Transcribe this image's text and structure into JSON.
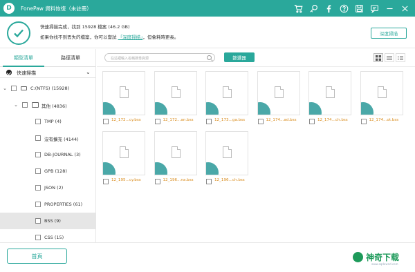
{
  "titlebar": {
    "logo_letter": "D",
    "app_name": "FonePaw 資料恢復（未註冊）",
    "icons": [
      "cart-icon",
      "key-icon",
      "facebook-icon",
      "help-icon",
      "save-icon",
      "feedback-icon",
      "minimize-icon",
      "close-icon"
    ]
  },
  "status": {
    "line1": "快速掃描完成，找到 15928 檔案 (46.2 GB)",
    "line2_prefix": "如果你找不到丟失的檔案，你可以嘗試 ",
    "line2_link": "「深度掃描」",
    "line2_suffix": "，但會耗時更長。",
    "deep_scan_button": "深度掃描"
  },
  "left": {
    "tabs": [
      "類型清單",
      "路徑清單"
    ],
    "mode_label": "快速掃描",
    "tree": [
      {
        "label": "C:(NTFS) (15928)",
        "level": 0,
        "type": "drive",
        "expanded": true
      },
      {
        "label": "其他 (4836)",
        "level": 1,
        "type": "folder",
        "expanded": true
      },
      {
        "label": "TMP (4)",
        "level": 2,
        "type": "item"
      },
      {
        "label": "沒有擴充 (4144)",
        "level": 2,
        "type": "item"
      },
      {
        "label": "DB-JOURNAL (3)",
        "level": 2,
        "type": "item"
      },
      {
        "label": "GPB (128)",
        "level": 2,
        "type": "item"
      },
      {
        "label": "JSON (2)",
        "level": 2,
        "type": "item"
      },
      {
        "label": "PROPERTIES (61)",
        "level": 2,
        "type": "item"
      },
      {
        "label": "BSS (9)",
        "level": 2,
        "type": "item",
        "selected": true
      },
      {
        "label": "CSS (15)",
        "level": 2,
        "type": "item"
      }
    ]
  },
  "toolbar": {
    "search_placeholder": "在這裡輸入名稱搜尋資源",
    "filter_button": "篩選器",
    "views": [
      "grid-view-icon",
      "list-view-icon",
      "detail-view-icon"
    ]
  },
  "files": [
    "12_172...cy.bss",
    "12_172...an.bss",
    "12_173...ga.bss",
    "12_174...ad.bss",
    "12_174...ch.bss",
    "12_174...ot.bss",
    "12_195...cy.bss",
    "12_196...na.bss",
    "12_196...ch.bss"
  ],
  "bottom": {
    "home_button": "首頁",
    "brand": "神奇下载",
    "brand_sub": "www.sqdownd.com"
  },
  "colors": {
    "accent": "#2aa89b",
    "file_name": "#d98b1b",
    "brand": "#1d9a5a"
  }
}
